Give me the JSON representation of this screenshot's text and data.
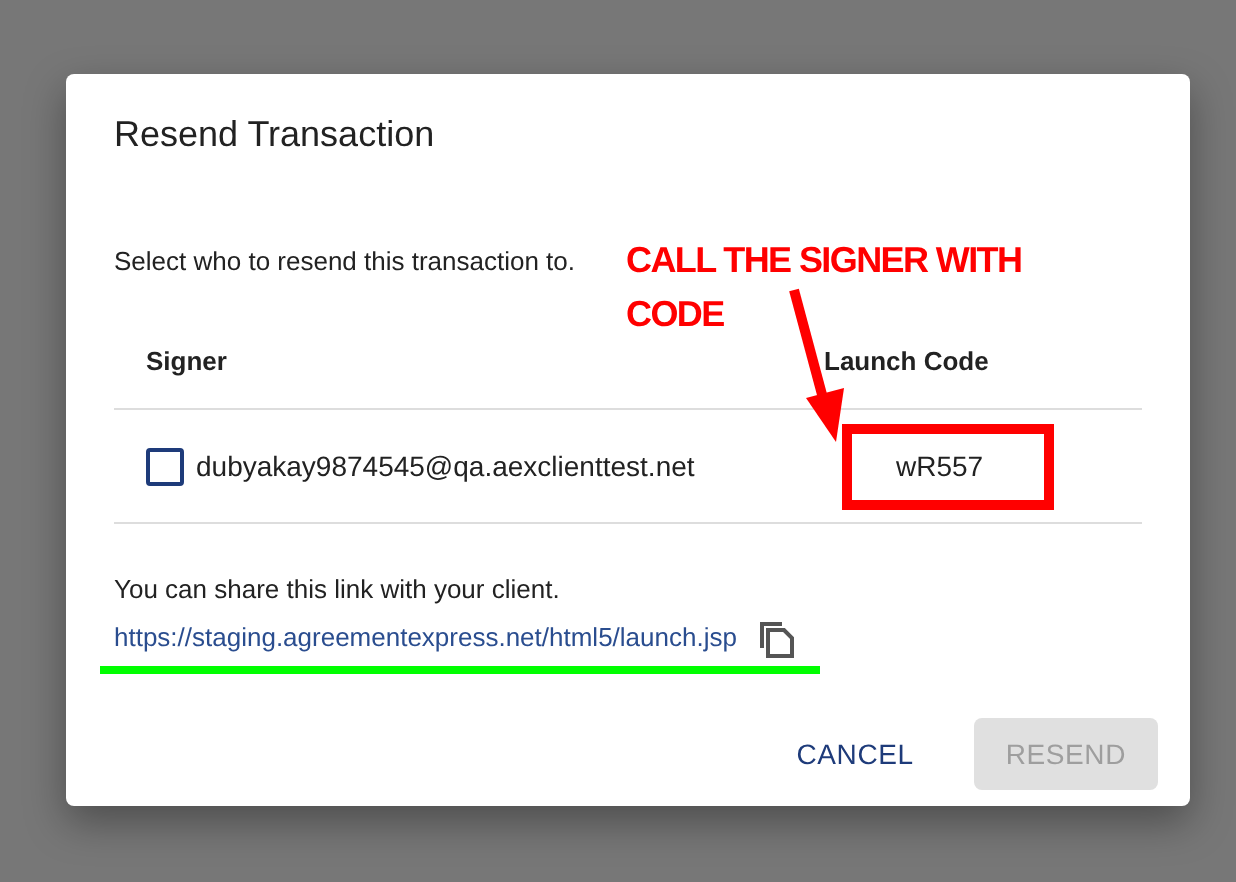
{
  "dialog": {
    "title": "Resend Transaction",
    "instruction": "Select who to resend this transaction to.",
    "columns": [
      "Signer",
      "Launch Code"
    ],
    "rows": [
      {
        "email": "dubyakay9874545@qa.aexclienttest.net",
        "checked": false,
        "code": "wR557"
      }
    ],
    "share_text": "You can share this link with your client.",
    "link": "https://staging.agreementexpress.net/html5/launch.jsp",
    "buttons": [
      {
        "label": "CANCEL",
        "disabled": false
      },
      {
        "label": "RESEND",
        "disabled": true
      }
    ]
  },
  "annotation": {
    "text": "CALL THE SIGNER WITH CODE"
  }
}
